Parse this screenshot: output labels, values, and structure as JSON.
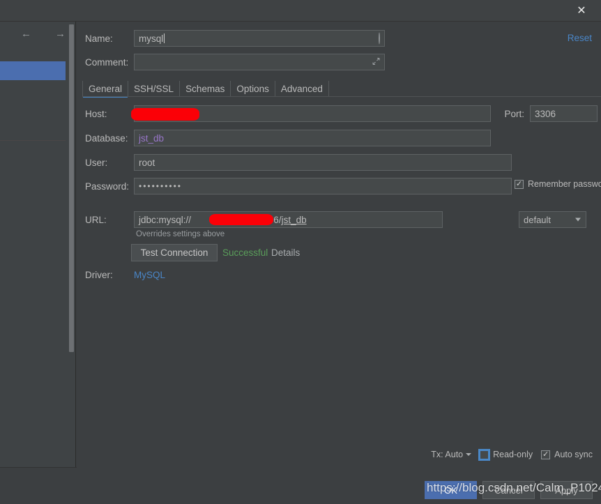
{
  "window": {
    "close_icon": "close-icon"
  },
  "sidebar": {
    "back_icon": "arrow-left-icon",
    "forward_icon": "arrow-right-icon"
  },
  "dialog": {
    "reset_label": "Reset",
    "name": {
      "label": "Name:",
      "value": "mysql",
      "icon": "circle-icon"
    },
    "comment": {
      "label": "Comment:",
      "value": "",
      "placeholder": "",
      "icon": "expand-icon"
    },
    "tabs": [
      {
        "label": "General",
        "active": true
      },
      {
        "label": "SSH/SSL",
        "active": false
      },
      {
        "label": "Schemas",
        "active": false
      },
      {
        "label": "Options",
        "active": false
      },
      {
        "label": "Advanced",
        "active": false
      }
    ],
    "general": {
      "host": {
        "label": "Host:",
        "value": "",
        "redacted": true
      },
      "port": {
        "label": "Port:",
        "value": "3306"
      },
      "database": {
        "label": "Database:",
        "value": "jst_db",
        "value_color": "#9876c8"
      },
      "user": {
        "label": "User:",
        "value": "root"
      },
      "password": {
        "label": "Password:",
        "value": "••••••••••"
      },
      "remember_password": {
        "label": "Remember password",
        "checked": true
      },
      "url": {
        "label": "URL:",
        "prefix": "jdbc:mysql://",
        "redacted_middle": true,
        "suffix_port": ":3306/",
        "suffix_db": "jst_db",
        "full_value": "jdbc:mysql://<redacted>:3306/jst_db"
      },
      "url_scheme_select": {
        "value": "default",
        "icon": "chevron-down-icon"
      },
      "overrides_note": "Overrides settings above",
      "test_connection_button": "Test Connection",
      "test_status": "Successful",
      "test_status_color": "#5a9e5a",
      "details_link": "Details",
      "driver": {
        "label": "Driver:",
        "value": "MySQL",
        "color": "#4a86c7"
      }
    }
  },
  "bottom_options": {
    "tx": {
      "label": "Tx: Auto",
      "icon": "chevron-down-icon"
    },
    "read_only": {
      "label": "Read-only",
      "checked": false,
      "focused": true
    },
    "auto_sync": {
      "label": "Auto sync",
      "checked": true
    }
  },
  "buttons": {
    "ok": "OK",
    "cancel": "Cancel",
    "apply": "Apply"
  },
  "watermark": {
    "text": "https://blog.csdn.net/Calm_P1024"
  },
  "colors": {
    "background": "#3c3f41",
    "field_background": "#45494a",
    "accent_blue": "#4b6eaf",
    "link_blue": "#4a86c7",
    "success_green": "#5a9e5a",
    "purple_value": "#9876c8",
    "redaction_red": "#fb0007"
  }
}
